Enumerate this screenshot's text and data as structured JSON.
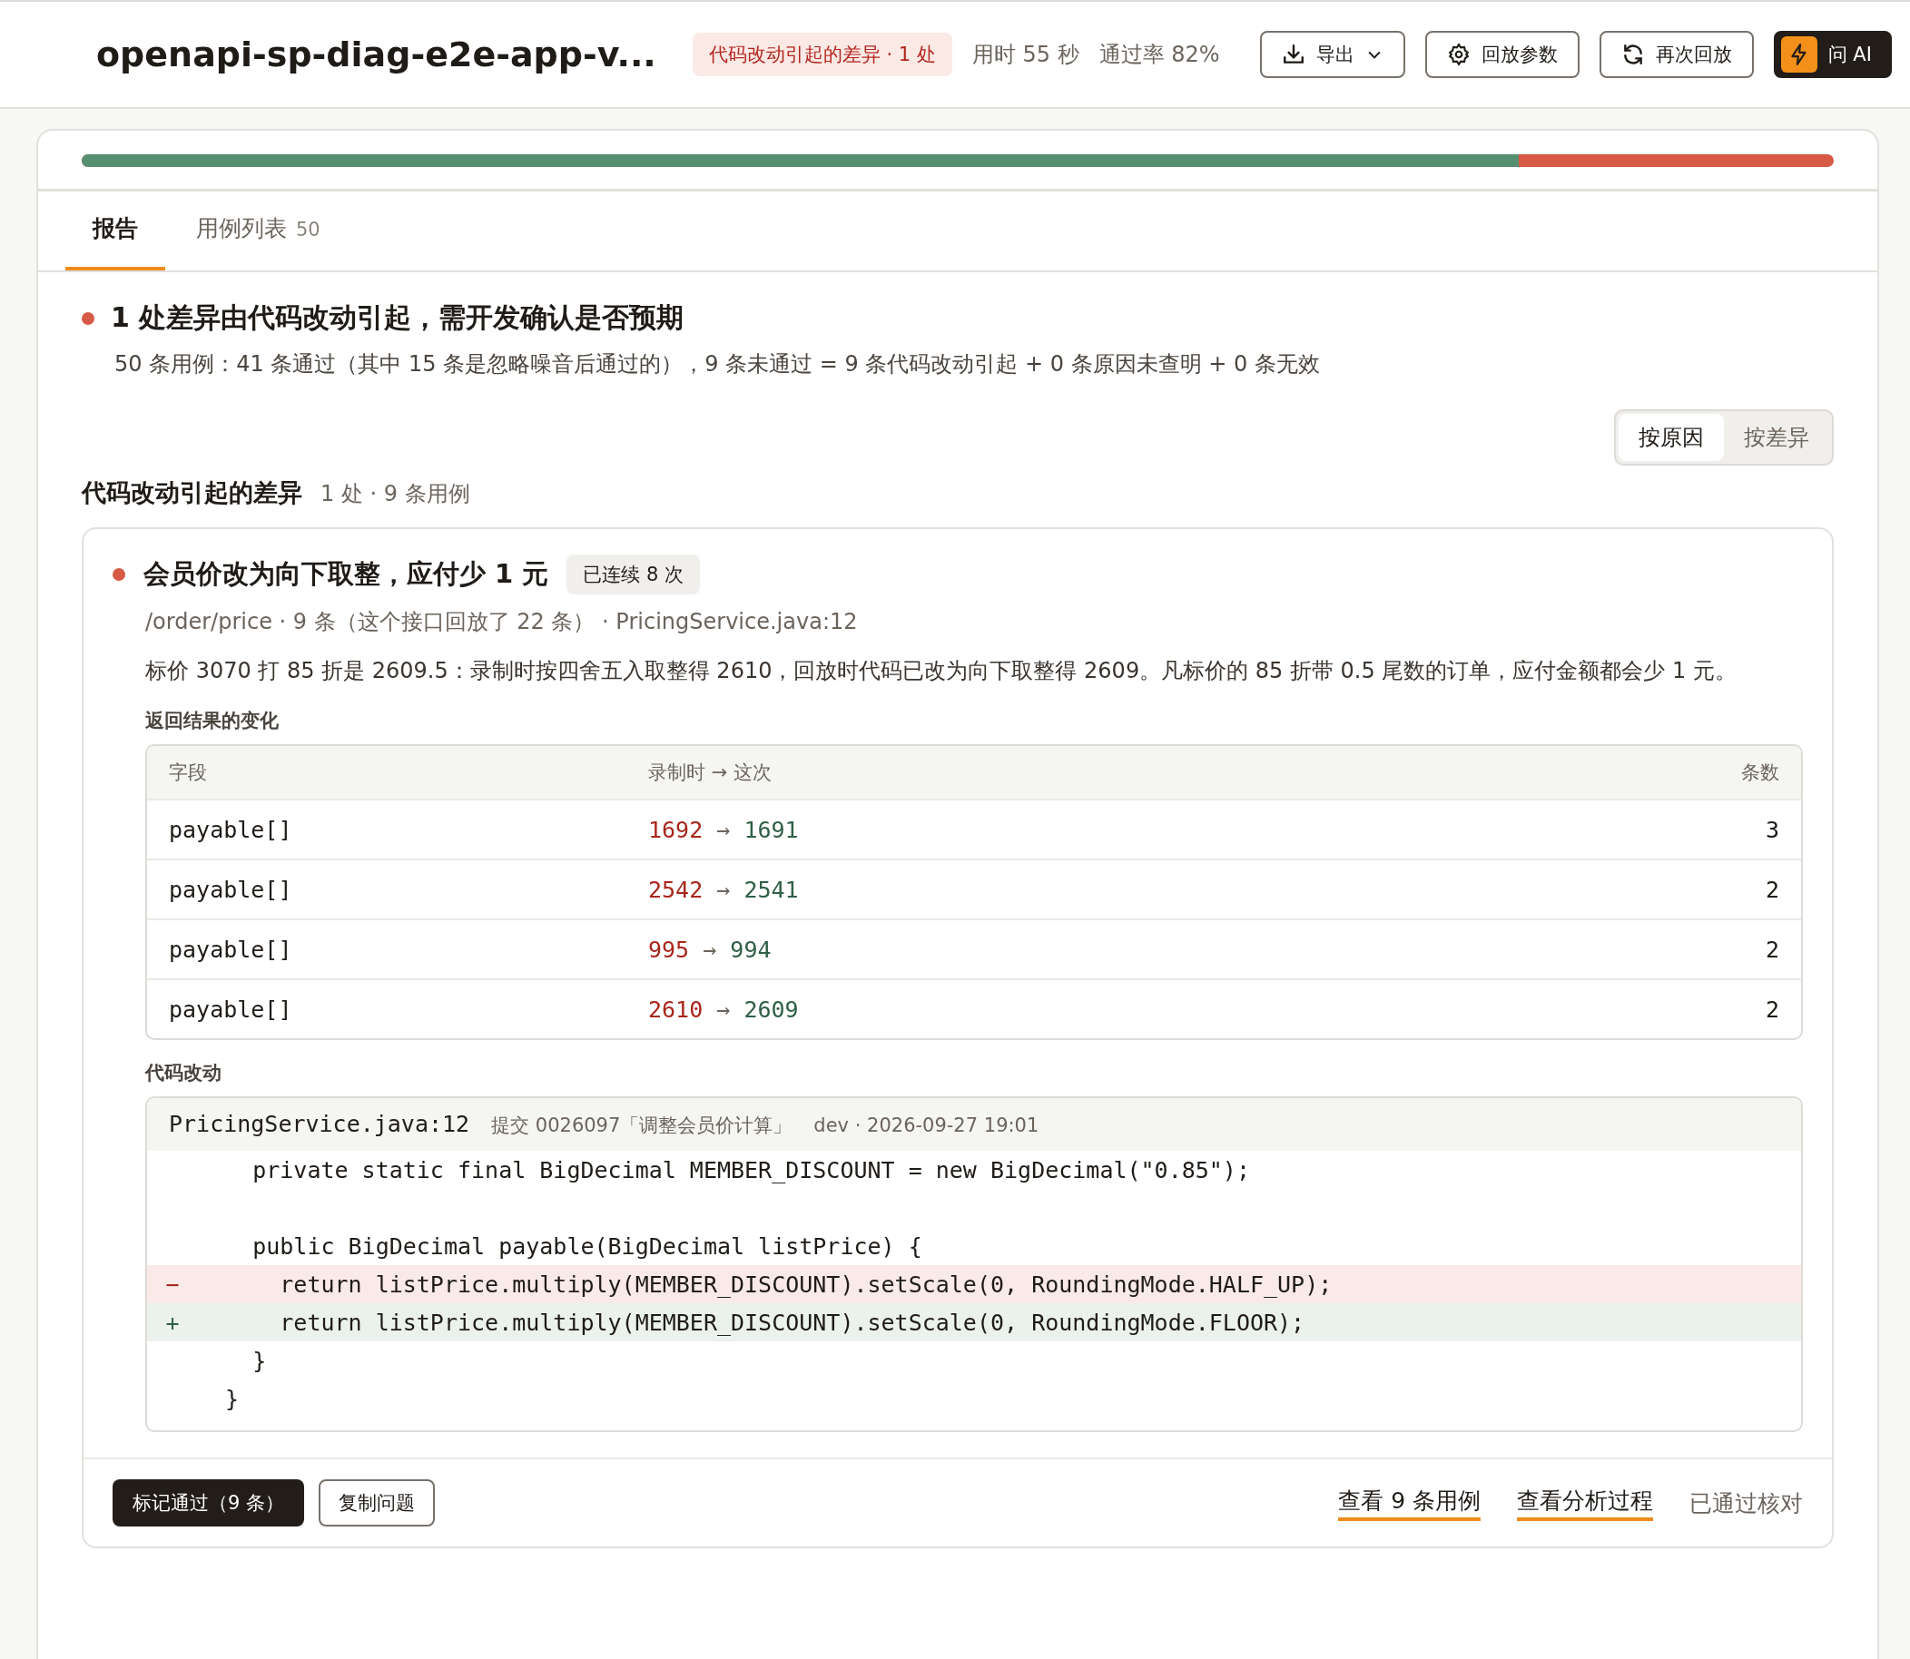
{
  "header": {
    "title": "openapi-sp-diag-e2e-app-v...",
    "badge": "代码改动引起的差异 · 1 处",
    "duration": "用时 55 秒",
    "pass_rate": "通过率 82%",
    "buttons": [
      {
        "kind": "export",
        "label": "导出"
      },
      {
        "kind": "params",
        "label": "回放参数"
      },
      {
        "kind": "replay",
        "label": "再次回放"
      },
      {
        "kind": "ai",
        "label": "问 AI"
      }
    ]
  },
  "progress": {
    "level": 0.82
  },
  "tabs": [
    {
      "label": "报告",
      "selected": true
    },
    {
      "label": "用例列表",
      "count": "50",
      "selected": false
    }
  ],
  "summary": {
    "title": "1 处差异由代码改动引起，需开发确认是否预期",
    "text": "50 条用例：41 条通过（其中 15 条是忽略噪音后通过的），9 条未通过 = 9 条代码改动引起 + 0 条原因未查明 + 0 条无效"
  },
  "view_toggle": [
    {
      "label": "按原因",
      "selected": true
    },
    {
      "label": "按差异",
      "selected": false
    }
  ],
  "section": {
    "title": "代码改动引起的差异",
    "meta": "1 处 · 9 条用例"
  },
  "issue": {
    "title": "会员价改为向下取整，应付少 1 元",
    "streak": "已连续 8 次",
    "meta": "/order/price · 9 条（这个接口回放了 22 条） · PricingService.java:12",
    "description": "标价 3070 打 85 折是 2609.5：录制时按四舍五入取整得 2610，回放时代码已改为向下取整得 2609。凡标价的 85 折带 0.5 尾数的订单，应付金额都会少 1 元。",
    "changes_label": "返回结果的变化",
    "table": {
      "columns": [
        "字段",
        "录制时 → 这次",
        "条数"
      ],
      "rows": [
        {
          "field": "payable[]",
          "before": "1692",
          "arrow": "→",
          "after": "1691",
          "count": "3"
        },
        {
          "field": "payable[]",
          "before": "2542",
          "arrow": "→",
          "after": "2541",
          "count": "2"
        },
        {
          "field": "payable[]",
          "before": "995",
          "arrow": "→",
          "after": "994",
          "count": "2"
        },
        {
          "field": "payable[]",
          "before": "2610",
          "arrow": "→",
          "after": "2609",
          "count": "2"
        }
      ]
    },
    "code_label": "代码改动",
    "code": {
      "file": "PricingService.java:12",
      "commit": "提交 0026097「调整会员价计算」",
      "branch": "dev · 2026-09-27 19:01",
      "lines": [
        {
          "kind": "context",
          "text": "    private static final BigDecimal MEMBER_DISCOUNT = new BigDecimal(\"0.85\");"
        },
        {
          "kind": "blank"
        },
        {
          "kind": "context",
          "text": "    public BigDecimal payable(BigDecimal listPrice) {"
        },
        {
          "kind": "del",
          "sign": "−",
          "text": "      return listPrice.multiply(MEMBER_DISCOUNT).setScale(0, RoundingMode.HALF_UP);"
        },
        {
          "kind": "add",
          "sign": "+",
          "text": "      return listPrice.multiply(MEMBER_DISCOUNT).setScale(0, RoundingMode.FLOOR);"
        },
        {
          "kind": "context",
          "text": "    }"
        },
        {
          "kind": "context",
          "text": "  }"
        }
      ]
    },
    "actions": {
      "primary": "标记通过（9 条）",
      "secondary": "复制问题",
      "links": [
        "查看 9 条用例",
        "查看分析过程"
      ],
      "status": "已通过核对"
    }
  }
}
